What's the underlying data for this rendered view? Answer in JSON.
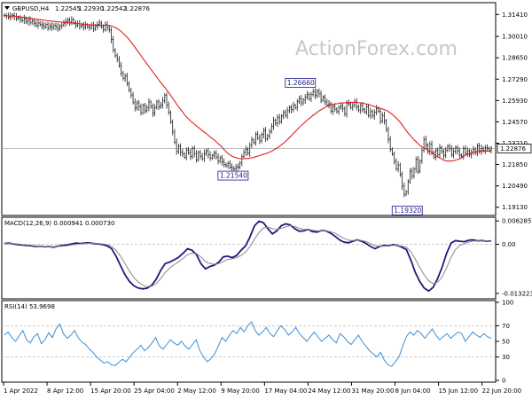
{
  "chart_data": [
    {
      "type": "candlestick",
      "title": "GBPUSD,H4",
      "ohlc": [
        "1.22545",
        "1.22930",
        "1.22542",
        "1.22876"
      ],
      "watermark": "ActionForex.com",
      "ylim": [
        1.1872,
        1.3205
      ],
      "y_ticks": [
        "1.31410",
        "1.30010",
        "1.28650",
        "1.27290",
        "1.25930",
        "1.24570",
        "1.23210",
        "1.21850",
        "1.20490",
        "1.19130"
      ],
      "current_price": "1.22876",
      "moving_average_color": "#e02020",
      "price_line_color": "#1a1a1a",
      "annotations": [
        {
          "label": "1.26660",
          "x_index": 150,
          "value": 1.2666
        },
        {
          "label": "1.21540",
          "x_index": 116,
          "value": 1.2154
        },
        {
          "label": "1.19320",
          "x_index": 204,
          "value": 1.1932
        }
      ],
      "close": [
        1.3135,
        1.3132,
        1.3124,
        1.313,
        1.3136,
        1.3128,
        1.3116,
        1.3121,
        1.3108,
        1.3102,
        1.3114,
        1.3096,
        1.3108,
        1.3088,
        1.31,
        1.3085,
        1.3072,
        1.3086,
        1.3079,
        1.3071,
        1.3062,
        1.3078,
        1.3056,
        1.3067,
        1.3058,
        1.3072,
        1.3064,
        1.3049,
        1.3068,
        1.3074,
        1.3086,
        1.3094,
        1.3106,
        1.3092,
        1.3108,
        1.3088,
        1.3072,
        1.3082,
        1.3067,
        1.3074,
        1.3062,
        1.3075,
        1.3062,
        1.3058,
        1.3072,
        1.3051,
        1.3066,
        1.3078,
        1.3088,
        1.3062,
        1.3045,
        1.3075,
        1.3058,
        1.3042,
        1.2982,
        1.2915,
        1.2878,
        1.2856,
        1.2815,
        1.2768,
        1.2735,
        1.2748,
        1.2702,
        1.2658,
        1.2628,
        1.2582,
        1.2545,
        1.2578,
        1.2552,
        1.2515,
        1.2562,
        1.2528,
        1.2546,
        1.2583,
        1.2556,
        1.2512,
        1.2548,
        1.2585,
        1.2553,
        1.2564,
        1.2591,
        1.2626,
        1.2565,
        1.2518,
        1.2456,
        1.2392,
        1.2328,
        1.2268,
        1.2302,
        1.2264,
        1.2252,
        1.2232,
        1.2278,
        1.2261,
        1.2236,
        1.2288,
        1.2255,
        1.2215,
        1.2262,
        1.2238,
        1.2222,
        1.2256,
        1.2272,
        1.2248,
        1.2226,
        1.2242,
        1.2258,
        1.2232,
        1.2208,
        1.2228,
        1.2202,
        1.2186,
        1.2178,
        1.2192,
        1.2168,
        1.2162,
        1.2157,
        1.2171,
        1.2168,
        1.2195,
        1.2236,
        1.2262,
        1.2282,
        1.2258,
        1.2308,
        1.2341,
        1.2325,
        1.2378,
        1.2354,
        1.2336,
        1.2376,
        1.2402,
        1.2348,
        1.2368,
        1.2396,
        1.2428,
        1.2465,
        1.2448,
        1.2486,
        1.2458,
        1.2494,
        1.2516,
        1.2498,
        1.2528,
        1.2548,
        1.2536,
        1.2562,
        1.2548,
        1.2586,
        1.2604,
        1.2578,
        1.2596,
        1.2616,
        1.2632,
        1.2604,
        1.2632,
        1.2648,
        1.2624,
        1.2652,
        1.2636,
        1.2594,
        1.2615,
        1.2584,
        1.2565,
        1.2572,
        1.2525,
        1.2555,
        1.2538,
        1.2522,
        1.2548,
        1.2556,
        1.2542,
        1.2508,
        1.2576,
        1.2572,
        1.2548,
        1.2562,
        1.2584,
        1.2552,
        1.2532,
        1.2562,
        1.2536,
        1.2521,
        1.2552,
        1.2498,
        1.2522,
        1.2495,
        1.2518,
        1.2542,
        1.2525,
        1.2462,
        1.2498,
        1.2462,
        1.2408,
        1.2345,
        1.2282,
        1.2252,
        1.2206,
        1.2158,
        1.2182,
        1.2122,
        1.2048,
        1.1995,
        1.2012,
        1.2076,
        1.2142,
        1.2112,
        1.2156,
        1.2218,
        1.2142,
        1.2208,
        1.2275,
        1.2345,
        1.2308,
        1.2268,
        1.2315,
        1.2262,
        1.2232,
        1.2274,
        1.2248,
        1.2292,
        1.2268,
        1.2244,
        1.2276,
        1.2302,
        1.2288,
        1.2246,
        1.2268,
        1.2292,
        1.2272,
        1.2244,
        1.2238,
        1.2288,
        1.2256,
        1.2272,
        1.2248,
        1.2264,
        1.2282,
        1.2258,
        1.2304,
        1.2268,
        1.2288,
        1.2276,
        1.2292,
        1.2288,
        1.2276,
        1.22876
      ],
      "x_tick_labels": [
        "1 Apr 2022",
        "8 Apr 12:00",
        "15 Apr 20:00",
        "25 Apr 04:00",
        "2 May 12:00",
        "9 May 20:00",
        "17 May 04:00",
        "24 May 12:00",
        "31 May 20:00",
        "8 Jun 04:00",
        "15 Jun 12:00",
        "22 Jun 20:00"
      ]
    },
    {
      "type": "line",
      "title": "MACD(12,26,9) 0.000941 0.000730",
      "ylim": [
        -0.0142,
        0.0068
      ],
      "y_ticks": [
        "0.006285",
        "0.00",
        "-0.013223"
      ],
      "series": [
        {
          "role": "macd",
          "color": "#1c1c7a",
          "values": [
            0.0002,
            0.0003,
            0.0001,
            -0.0001,
            -0.0002,
            -0.0003,
            -0.0004,
            -0.0006,
            -0.0005,
            -0.0007,
            -0.0006,
            -0.0008,
            -0.0005,
            -0.0003,
            -0.0002,
            0.0001,
            0.0003,
            0.0002,
            0.0003,
            0.0004,
            0.0002,
            0.0001,
            -0.0001,
            -0.0004,
            -0.0012,
            -0.0032,
            -0.0058,
            -0.0082,
            -0.01,
            -0.0112,
            -0.0118,
            -0.012,
            -0.0118,
            -0.011,
            -0.0094,
            -0.007,
            -0.0052,
            -0.0048,
            -0.0042,
            -0.0035,
            -0.0024,
            -0.0012,
            -0.0016,
            -0.0028,
            -0.0052,
            -0.0066,
            -0.006,
            -0.0056,
            -0.0048,
            -0.0034,
            -0.0032,
            -0.0036,
            -0.003,
            -0.0016,
            -0.0004,
            0.002,
            0.005,
            0.0062,
            0.0058,
            0.0042,
            0.0028,
            0.0036,
            0.005,
            0.0055,
            0.0052,
            0.0042,
            0.0035,
            0.0036,
            0.004,
            0.0034,
            0.0033,
            0.0037,
            0.0036,
            0.003,
            0.0022,
            0.0012,
            0.0006,
            0.0004,
            0.0008,
            0.0012,
            0.0008,
            0.0002,
            -0.0006,
            -0.0012,
            -0.0006,
            -0.0003,
            -0.0004,
            -0.0001,
            -0.0003,
            -0.0008,
            -0.0014,
            -0.0042,
            -0.0076,
            -0.01,
            -0.0118,
            -0.0126,
            -0.0116,
            -0.0092,
            -0.0062,
            -0.0025,
            0.0003,
            0.001,
            0.0008,
            0.0007,
            0.0011,
            0.0012,
            0.0009,
            0.001,
            0.0008,
            0.00094
          ]
        },
        {
          "role": "signal",
          "color": "#888888",
          "values": [
            0.0002,
            0.0002,
            0.0002,
            0.0001,
            -0.0001,
            -0.0002,
            -0.0003,
            -0.0004,
            -0.0005,
            -0.0006,
            -0.0006,
            -0.0007,
            -0.0006,
            -0.0005,
            -0.0004,
            -0.0002,
            0.0,
            0.0001,
            0.0002,
            0.0003,
            0.0003,
            0.0002,
            0.0001,
            -0.0001,
            -0.0006,
            -0.0016,
            -0.0032,
            -0.0052,
            -0.0072,
            -0.009,
            -0.0102,
            -0.011,
            -0.0114,
            -0.0113,
            -0.0106,
            -0.0092,
            -0.0076,
            -0.0064,
            -0.0055,
            -0.0047,
            -0.0038,
            -0.0028,
            -0.0024,
            -0.0025,
            -0.0034,
            -0.0046,
            -0.0052,
            -0.0054,
            -0.0052,
            -0.0046,
            -0.0041,
            -0.0039,
            -0.0036,
            -0.003,
            -0.0021,
            -0.0006,
            0.0014,
            0.0032,
            0.0044,
            0.0046,
            0.0042,
            0.004,
            0.0043,
            0.0047,
            0.005,
            0.0048,
            0.0043,
            0.004,
            0.004,
            0.0038,
            0.0036,
            0.0036,
            0.0036,
            0.0034,
            0.003,
            0.0023,
            0.0016,
            0.0011,
            0.001,
            0.0011,
            0.001,
            0.0007,
            0.0002,
            -0.0004,
            -0.0005,
            -0.0005,
            -0.0004,
            -0.0003,
            -0.0003,
            -0.0005,
            -0.0008,
            -0.002,
            -0.004,
            -0.0062,
            -0.0082,
            -0.0098,
            -0.0106,
            -0.0102,
            -0.0088,
            -0.0064,
            -0.0035,
            -0.0014,
            -0.0003,
            0.0002,
            0.0006,
            0.0009,
            0.0009,
            0.0009,
            0.0009,
            0.00073
          ]
        }
      ]
    },
    {
      "type": "line",
      "title": "RSI(14) 53.9698",
      "ylim": [
        0,
        100
      ],
      "y_ticks": [
        "100",
        "70",
        "50",
        "30",
        "0"
      ],
      "series": [
        {
          "role": "rsi",
          "color": "#3a8fd8",
          "values": [
            58,
            62,
            55,
            50,
            57,
            64,
            52,
            48,
            56,
            60,
            47,
            52,
            61,
            55,
            66,
            72,
            60,
            54,
            58,
            64,
            55,
            49,
            46,
            40,
            36,
            30,
            26,
            22,
            24,
            20,
            19,
            23,
            27,
            24,
            30,
            36,
            40,
            45,
            38,
            42,
            48,
            55,
            44,
            40,
            46,
            52,
            48,
            45,
            50,
            44,
            40,
            46,
            52,
            38,
            30,
            24,
            28,
            34,
            44,
            55,
            50,
            58,
            64,
            60,
            68,
            62,
            70,
            75,
            64,
            58,
            62,
            68,
            60,
            56,
            64,
            70,
            65,
            58,
            62,
            68,
            60,
            55,
            50,
            56,
            62,
            56,
            50,
            54,
            58,
            52,
            48,
            60,
            56,
            50,
            46,
            52,
            58,
            50,
            44,
            38,
            34,
            30,
            36,
            26,
            20,
            18,
            24,
            30,
            44,
            56,
            62,
            58,
            64,
            60,
            54,
            60,
            66,
            58,
            52,
            56,
            60,
            54,
            58,
            62,
            60,
            50,
            56,
            62,
            58,
            55,
            60,
            56,
            53.9698
          ]
        }
      ]
    }
  ]
}
